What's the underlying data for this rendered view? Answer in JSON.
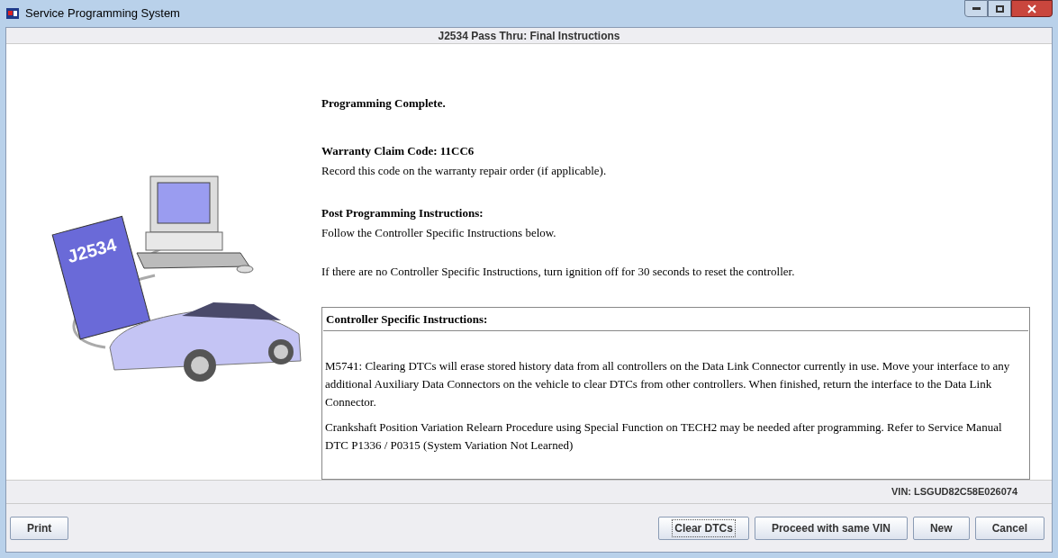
{
  "window": {
    "title": "Service Programming System"
  },
  "header": "J2534 Pass Thru: Final Instructions",
  "illustration": {
    "device_label": "J2534"
  },
  "status": "Programming Complete.",
  "warranty": {
    "title": "Warranty Claim Code: 11CC6",
    "text": "Record this code on the warranty repair order (if applicable)."
  },
  "post": {
    "title": "Post Programming Instructions:",
    "text": "Follow the Controller Specific Instructions below.",
    "note": "If there are no Controller Specific Instructions, turn ignition off for 30 seconds to reset the controller."
  },
  "controller_box": {
    "title": "Controller Specific Instructions:",
    "paragraphs": [
      "M5741: Clearing DTCs will erase stored history data from all controllers on the Data Link Connector currently in use. Move your interface to any additional Auxiliary Data Connectors on the vehicle to clear DTCs from other controllers. When finished, return the interface to the Data Link Connector.",
      "Crankshaft Position Variation Relearn Procedure using Special Function on TECH2 may be needed after programming. Refer to Service Manual DTC P1336 / P0315 (System Variation Not Learned)"
    ]
  },
  "vin": "VIN: LSGUD82C58E026074",
  "buttons_left": [
    {
      "label": "Print",
      "focused": false
    }
  ],
  "buttons_right": [
    {
      "label": "Clear DTCs",
      "focused": true
    },
    {
      "label": "Proceed with same VIN",
      "focused": false
    },
    {
      "label": "New",
      "focused": false
    },
    {
      "label": "Cancel",
      "focused": false
    }
  ]
}
